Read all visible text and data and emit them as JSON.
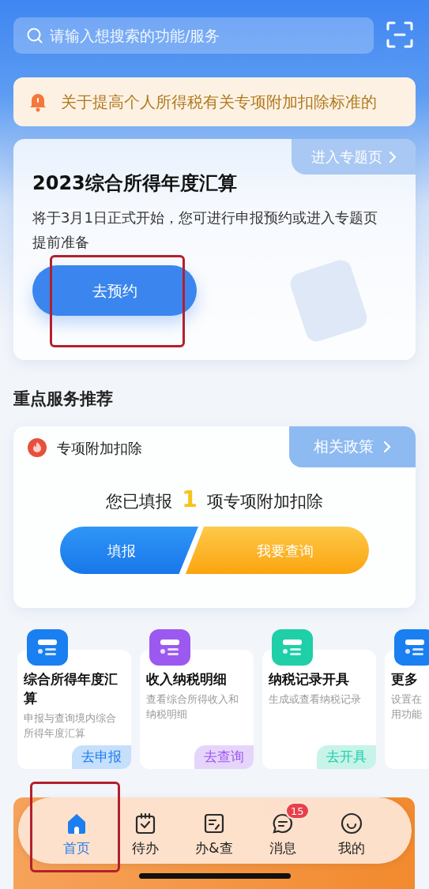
{
  "search": {
    "placeholder": "请输入想搜索的功能/服务"
  },
  "notice": {
    "text": "关于提高个人所得税有关专项附加扣除标准的"
  },
  "feature_card": {
    "link": "进入专题页",
    "title": "2023综合所得年度汇算",
    "description": "将于3月1日正式开始，您可进行申报预约或进入专题页提前准备",
    "button": "去预约"
  },
  "section_title": "重点服务推荐",
  "deduction_card": {
    "title": "专项附加扣除",
    "link": "相关政策",
    "summary_before": "您已填报",
    "count": "1",
    "summary_after": "项专项附加扣除",
    "buttons": [
      {
        "label": "填报",
        "kind": "primary"
      },
      {
        "label": "我要查询",
        "kind": "secondary"
      }
    ]
  },
  "services": [
    {
      "title": "综合所得年度汇算",
      "desc_lines": [
        "申报与查询境内综合",
        "所得年度汇算"
      ],
      "action": "去申报",
      "color": "#1a7ff0"
    },
    {
      "title": "收入纳税明细",
      "desc_lines": [
        "查看综合所得收入和",
        "纳税明细"
      ],
      "action": "去查询",
      "color": "#9b59f0"
    },
    {
      "title": "纳税记录开具",
      "desc_lines": [
        "生成或查看纳税记录"
      ],
      "action": "去开具",
      "color": "#1fcfa8"
    },
    {
      "title": "更多",
      "desc_lines": [
        "设置在",
        "用功能"
      ],
      "color": "#1a7ff0"
    }
  ],
  "tab_bar": [
    {
      "label": "首页",
      "selected": true
    },
    {
      "label": "待办",
      "selected": false
    },
    {
      "label": "办&查",
      "selected": false
    },
    {
      "label": "消息",
      "selected": false,
      "badge": "15"
    },
    {
      "label": "我的",
      "selected": false
    }
  ]
}
